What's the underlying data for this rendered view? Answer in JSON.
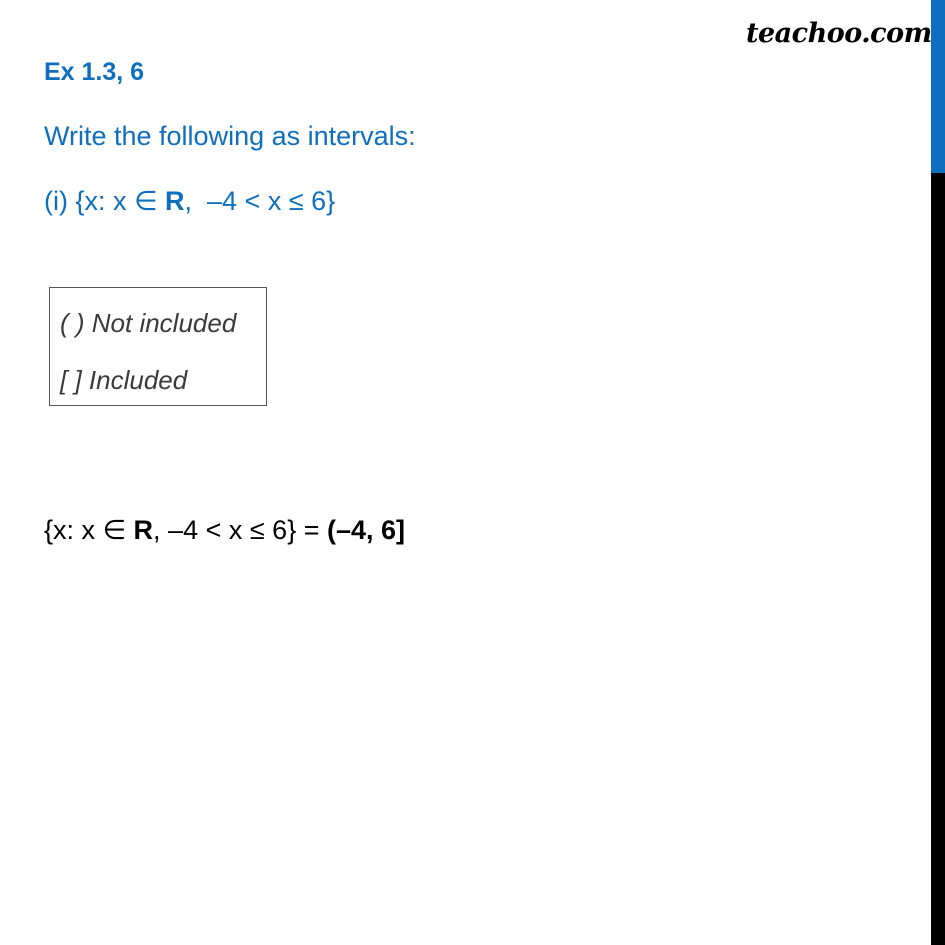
{
  "brand": {
    "logo_text": "teachoo.com",
    "accent_color": "#0e6fbe",
    "sidebar_lower_color": "#000000"
  },
  "heading": {
    "exercise": "Ex 1.3, 6"
  },
  "question": {
    "prompt": "Write the following as intervals:",
    "part_label": "(i) {x: x ∈ ",
    "part_set_symbol": "R",
    "part_condition": ",  –4 < x ≤ 6}"
  },
  "legend": {
    "not_included": "( ) Not included",
    "included": "[ ] Included"
  },
  "answer": {
    "lhs_prefix": "{x: x ∈ ",
    "lhs_set_symbol": "R",
    "lhs_condition": ", –4 < x ≤ 6} = ",
    "result": "(–4, 6]"
  }
}
